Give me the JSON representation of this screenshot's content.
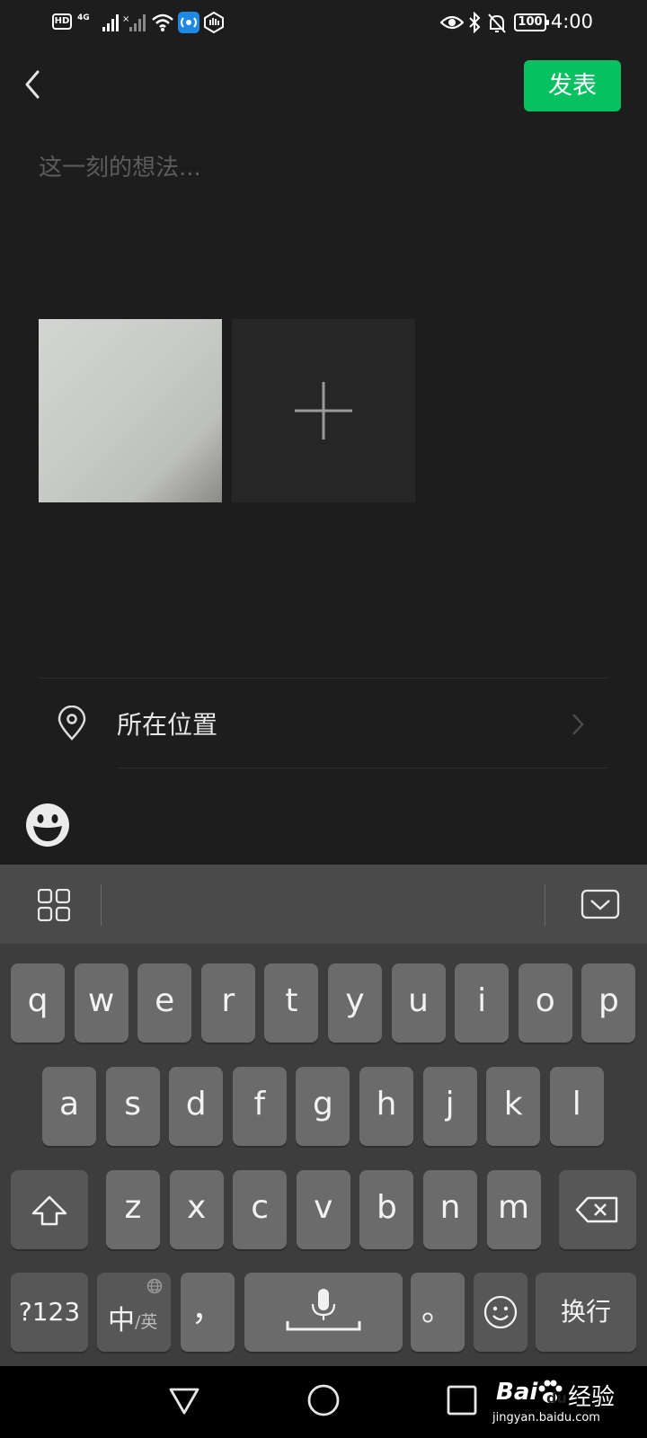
{
  "status_bar": {
    "hd_label": "HD",
    "network_label": "4G",
    "battery": "100",
    "time": "4:00"
  },
  "header": {
    "back_icon": "chevron-left-icon",
    "publish_label": "发表",
    "accent_color": "#07c160"
  },
  "composer": {
    "placeholder": "这一刻的想法..."
  },
  "media": {
    "add_icon": "plus-icon"
  },
  "location": {
    "icon": "location-pin-icon",
    "label": "所在位置"
  },
  "keyboard": {
    "row1": [
      "q",
      "w",
      "e",
      "r",
      "t",
      "y",
      "u",
      "i",
      "o",
      "p"
    ],
    "row2": [
      "a",
      "s",
      "d",
      "f",
      "g",
      "h",
      "j",
      "k",
      "l"
    ],
    "row3": [
      "z",
      "x",
      "c",
      "v",
      "b",
      "n",
      "m"
    ],
    "symbols_label": "?123",
    "lang_main": "中",
    "lang_alt": "/英",
    "comma": "，",
    "period": "。",
    "enter_label": "换行"
  },
  "watermark": {
    "brand": "Bai",
    "brand2": "du",
    "product": "经验",
    "url": "jingyan.baidu.com"
  }
}
